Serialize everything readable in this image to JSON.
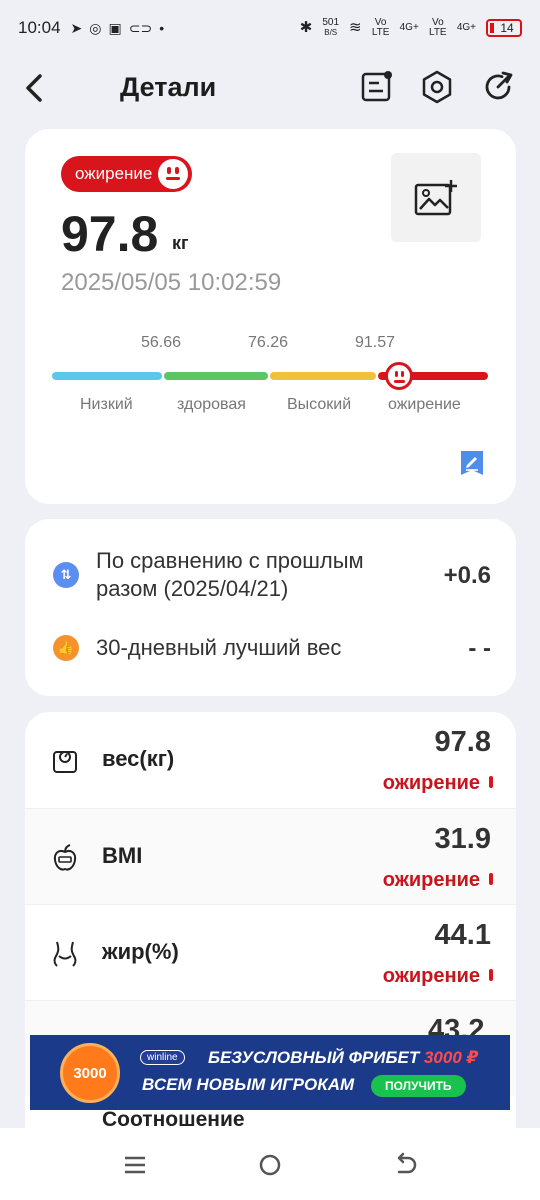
{
  "status_bar": {
    "time": "10:04",
    "net_speed": "501",
    "net_unit": "B/S",
    "sim1": "Vo LTE",
    "sim1_net": "4G+",
    "sim2": "Vo LTE",
    "sim2_net": "4G+",
    "battery": "14"
  },
  "header": {
    "title": "Детали",
    "icons": [
      "back-arrow-icon",
      "report-icon",
      "settings-hex-icon",
      "share-refresh-icon"
    ]
  },
  "summary": {
    "status_badge": "ожирение",
    "weight": "97.8",
    "unit": "кг",
    "datetime": "2025/05/05 10:02:59",
    "thresholds": [
      "56.66",
      "76.26",
      "91.57"
    ],
    "ranges": [
      {
        "label": "Низкий",
        "color": "#5ac8e8"
      },
      {
        "label": "здоровая",
        "color": "#5cc665"
      },
      {
        "label": "Высокий",
        "color": "#f0c23c"
      },
      {
        "label": "ожирение",
        "color": "#d8141c"
      }
    ]
  },
  "comparison": {
    "prev_label": "По сравнению с прошлым разом (2025/04/21)",
    "prev_value": "+0.6",
    "best_label": "30-дневный лучший вес",
    "best_value": "- -"
  },
  "metrics": [
    {
      "name": "вес(кг)",
      "value": "97.8",
      "status": "ожирение",
      "icon": "scale-icon"
    },
    {
      "name": "BMI",
      "value": "31.9",
      "status": "ожирение",
      "icon": "apple-icon"
    },
    {
      "name": "жир(%)",
      "value": "44.1",
      "status": "ожирение",
      "icon": "waist-icon"
    }
  ],
  "partial_metric": {
    "value": "43.2",
    "name": "Соотношение"
  },
  "ad": {
    "brand": "winline",
    "coin": "3000",
    "line1": "БЕЗУСЛОВНЫЙ ФРИБЕТ",
    "line1_accent": "3000 ₽",
    "line2": "ВСЕМ НОВЫМ ИГРОКАМ",
    "cta": "ПОЛУЧИТЬ"
  },
  "colors": {
    "accent_red": "#d8141c",
    "background": "#eef0f5"
  }
}
